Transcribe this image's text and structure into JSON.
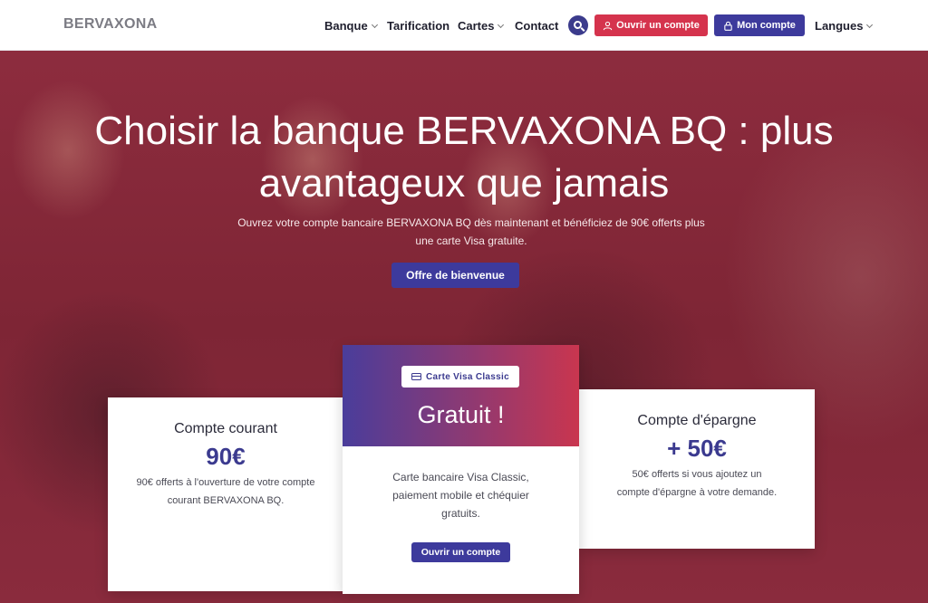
{
  "header": {
    "brand": "BERVAXONA",
    "nav": [
      {
        "label": "Banque"
      },
      {
        "label": "Tarification"
      },
      {
        "label": "Cartes"
      },
      {
        "label": "Contact"
      }
    ],
    "search_icon": "search-icon",
    "open_account_label": "Ouvrir un compte",
    "my_account_label": "Mon compte",
    "languages_label": "Langues"
  },
  "hero": {
    "title": "Choisir la banque BERVAXONA BQ : plus avantageux que jamais",
    "subtitle": "Ouvrez votre compte bancaire BERVAXONA BQ dès maintenant et bénéficiez de 90€ offerts plus une carte Visa gratuite.",
    "cta_label": "Offre de bienvenue"
  },
  "cards": {
    "current": {
      "title": "Compte courant",
      "amount": "90€",
      "description": "90€ offerts à l'ouverture de votre compte courant BERVAXONA BQ."
    },
    "visa": {
      "badge": "Carte Visa Classic",
      "title": "Gratuit !",
      "description": "Carte bancaire Visa Classic, paiement mobile et chéquier gratuits.",
      "button_label": "Ouvrir un compte"
    },
    "savings": {
      "title": "Compte d'épargne",
      "amount": "+ 50€",
      "description": "50€ offerts si vous ajoutez un compte d'épargne à votre demande."
    }
  },
  "colors": {
    "primary": "#3d3a9c",
    "accent": "#d5334d",
    "hero_overlay": "#8a2b3d"
  }
}
